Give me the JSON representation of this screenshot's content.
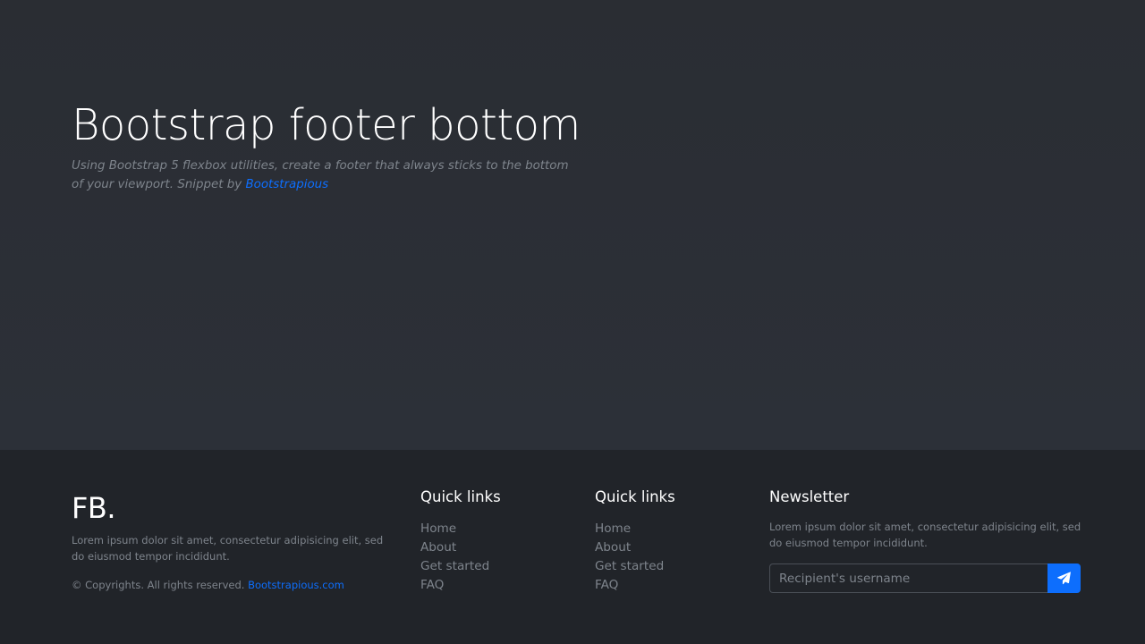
{
  "hero": {
    "title": "Bootstrap footer bottom",
    "subtitle_text": "Using Bootstrap 5 flexbox utilities, create a footer that always sticks to the bottom of your viewport. Snippet by ",
    "subtitle_link": "Bootstrapious"
  },
  "footer": {
    "brand": "FB.",
    "brand_desc": "Lorem ipsum dolor sit amet, consectetur adipisicing elit, sed do eiusmod tempor incididunt.",
    "copyright_text": "© Copyrights. All rights reserved. ",
    "copyright_link": "Bootstrapious.com",
    "columns": [
      {
        "title": "Quick links",
        "links": [
          "Home",
          "About",
          "Get started",
          "FAQ"
        ]
      },
      {
        "title": "Quick links",
        "links": [
          "Home",
          "About",
          "Get started",
          "FAQ"
        ]
      }
    ],
    "newsletter": {
      "title": "Newsletter",
      "desc": "Lorem ipsum dolor sit amet, consectetur adipisicing elit, sed do eiusmod tempor incididunt.",
      "placeholder": "Recipient's username",
      "button_icon": "paper-plane-icon"
    }
  },
  "colors": {
    "accent": "#0d6efd",
    "hero_bg": "#2b2f36",
    "footer_bg": "#212429",
    "muted_text": "#7e848c"
  }
}
